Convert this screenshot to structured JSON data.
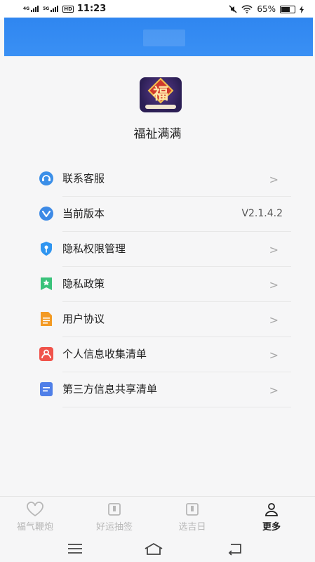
{
  "status_bar": {
    "net1": "4G",
    "net2": "5G",
    "hd": "HD",
    "time": "11:23",
    "battery": "65%"
  },
  "app": {
    "name": "福祉满满",
    "logo_text": "福"
  },
  "menu": [
    {
      "label": "联系客服",
      "icon": "headset-icon",
      "color": "#3b8fe8",
      "chevron": ">"
    },
    {
      "label": "当前版本",
      "icon": "version-icon",
      "color": "#3d8ae6",
      "value": "V2.1.4.2"
    },
    {
      "label": "隐私权限管理",
      "icon": "shield-key-icon",
      "color": "#2f95f0",
      "chevron": ">"
    },
    {
      "label": "隐私政策",
      "icon": "policy-bookmark-icon",
      "color": "#39c27a",
      "chevron": ">"
    },
    {
      "label": "用户协议",
      "icon": "document-icon",
      "color": "#f39a24",
      "chevron": ">"
    },
    {
      "label": "个人信息收集清单",
      "icon": "person-card-icon",
      "color": "#f0534b",
      "chevron": ">"
    },
    {
      "label": "第三方信息共享清单",
      "icon": "list-doc-icon",
      "color": "#4f7fe8",
      "chevron": ">"
    }
  ],
  "tabs": [
    {
      "label": "福气鞭炮",
      "icon": "heart-icon"
    },
    {
      "label": "好运抽签",
      "icon": "lot-icon"
    },
    {
      "label": "选吉日",
      "icon": "calendar-icon"
    },
    {
      "label": "更多",
      "icon": "person-icon",
      "active": true
    }
  ]
}
